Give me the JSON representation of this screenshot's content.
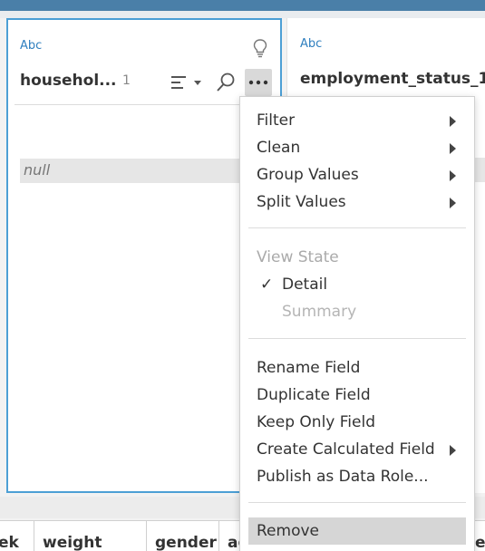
{
  "left_card": {
    "type_label": "Abc",
    "field_name": "househol...",
    "count": "1",
    "null_value": "null"
  },
  "right_card": {
    "type_label": "Abc",
    "field_name": "employment_status_1"
  },
  "grid_columns": [
    "ek",
    "weight",
    "gender",
    "ag",
    "e"
  ],
  "menu": {
    "filter": "Filter",
    "clean": "Clean",
    "group_values": "Group Values",
    "split_values": "Split Values",
    "view_state": "View State",
    "check": "✓",
    "detail": "Detail",
    "summary": "Summary",
    "rename_field": "Rename Field",
    "duplicate_field": "Duplicate Field",
    "keep_only_field": "Keep Only Field",
    "create_calculated_field": "Create Calculated Field",
    "publish_as_data_role": "Publish as Data Role...",
    "remove": "Remove"
  },
  "colors": {
    "top_bar": "#4a7fa8",
    "selected_border": "#4c9fd5",
    "type_label": "#2f7fbf",
    "menu_highlight": "#d6d6d6"
  },
  "icons": [
    "lightbulb-icon",
    "sort-icon",
    "search-icon",
    "more-options-icon",
    "submenu-arrow-icon",
    "checkmark-icon"
  ]
}
